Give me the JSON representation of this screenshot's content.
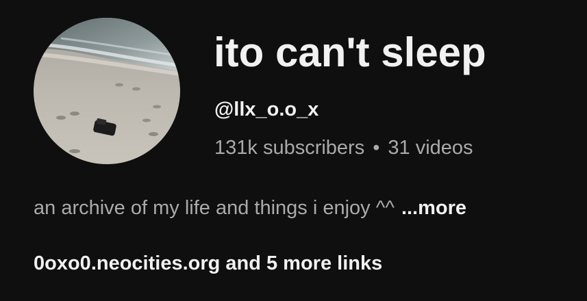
{
  "channel": {
    "name": "ito can't sleep",
    "handle": "@llx_o.o_x",
    "subscribers": "131k subscribers",
    "separator": "•",
    "videos": "31 videos",
    "description": "an archive of my life and things i enjoy ^^",
    "more_label": "...more",
    "link_url": "0oxo0.neocities.org",
    "more_links_label": "and 5 more links"
  },
  "avatar": {
    "icon": "channel-avatar-beach-photo"
  },
  "colors": {
    "background": "#0f0f0f",
    "primary_text": "#f1f1f1",
    "secondary_text": "#aaaaaa"
  }
}
